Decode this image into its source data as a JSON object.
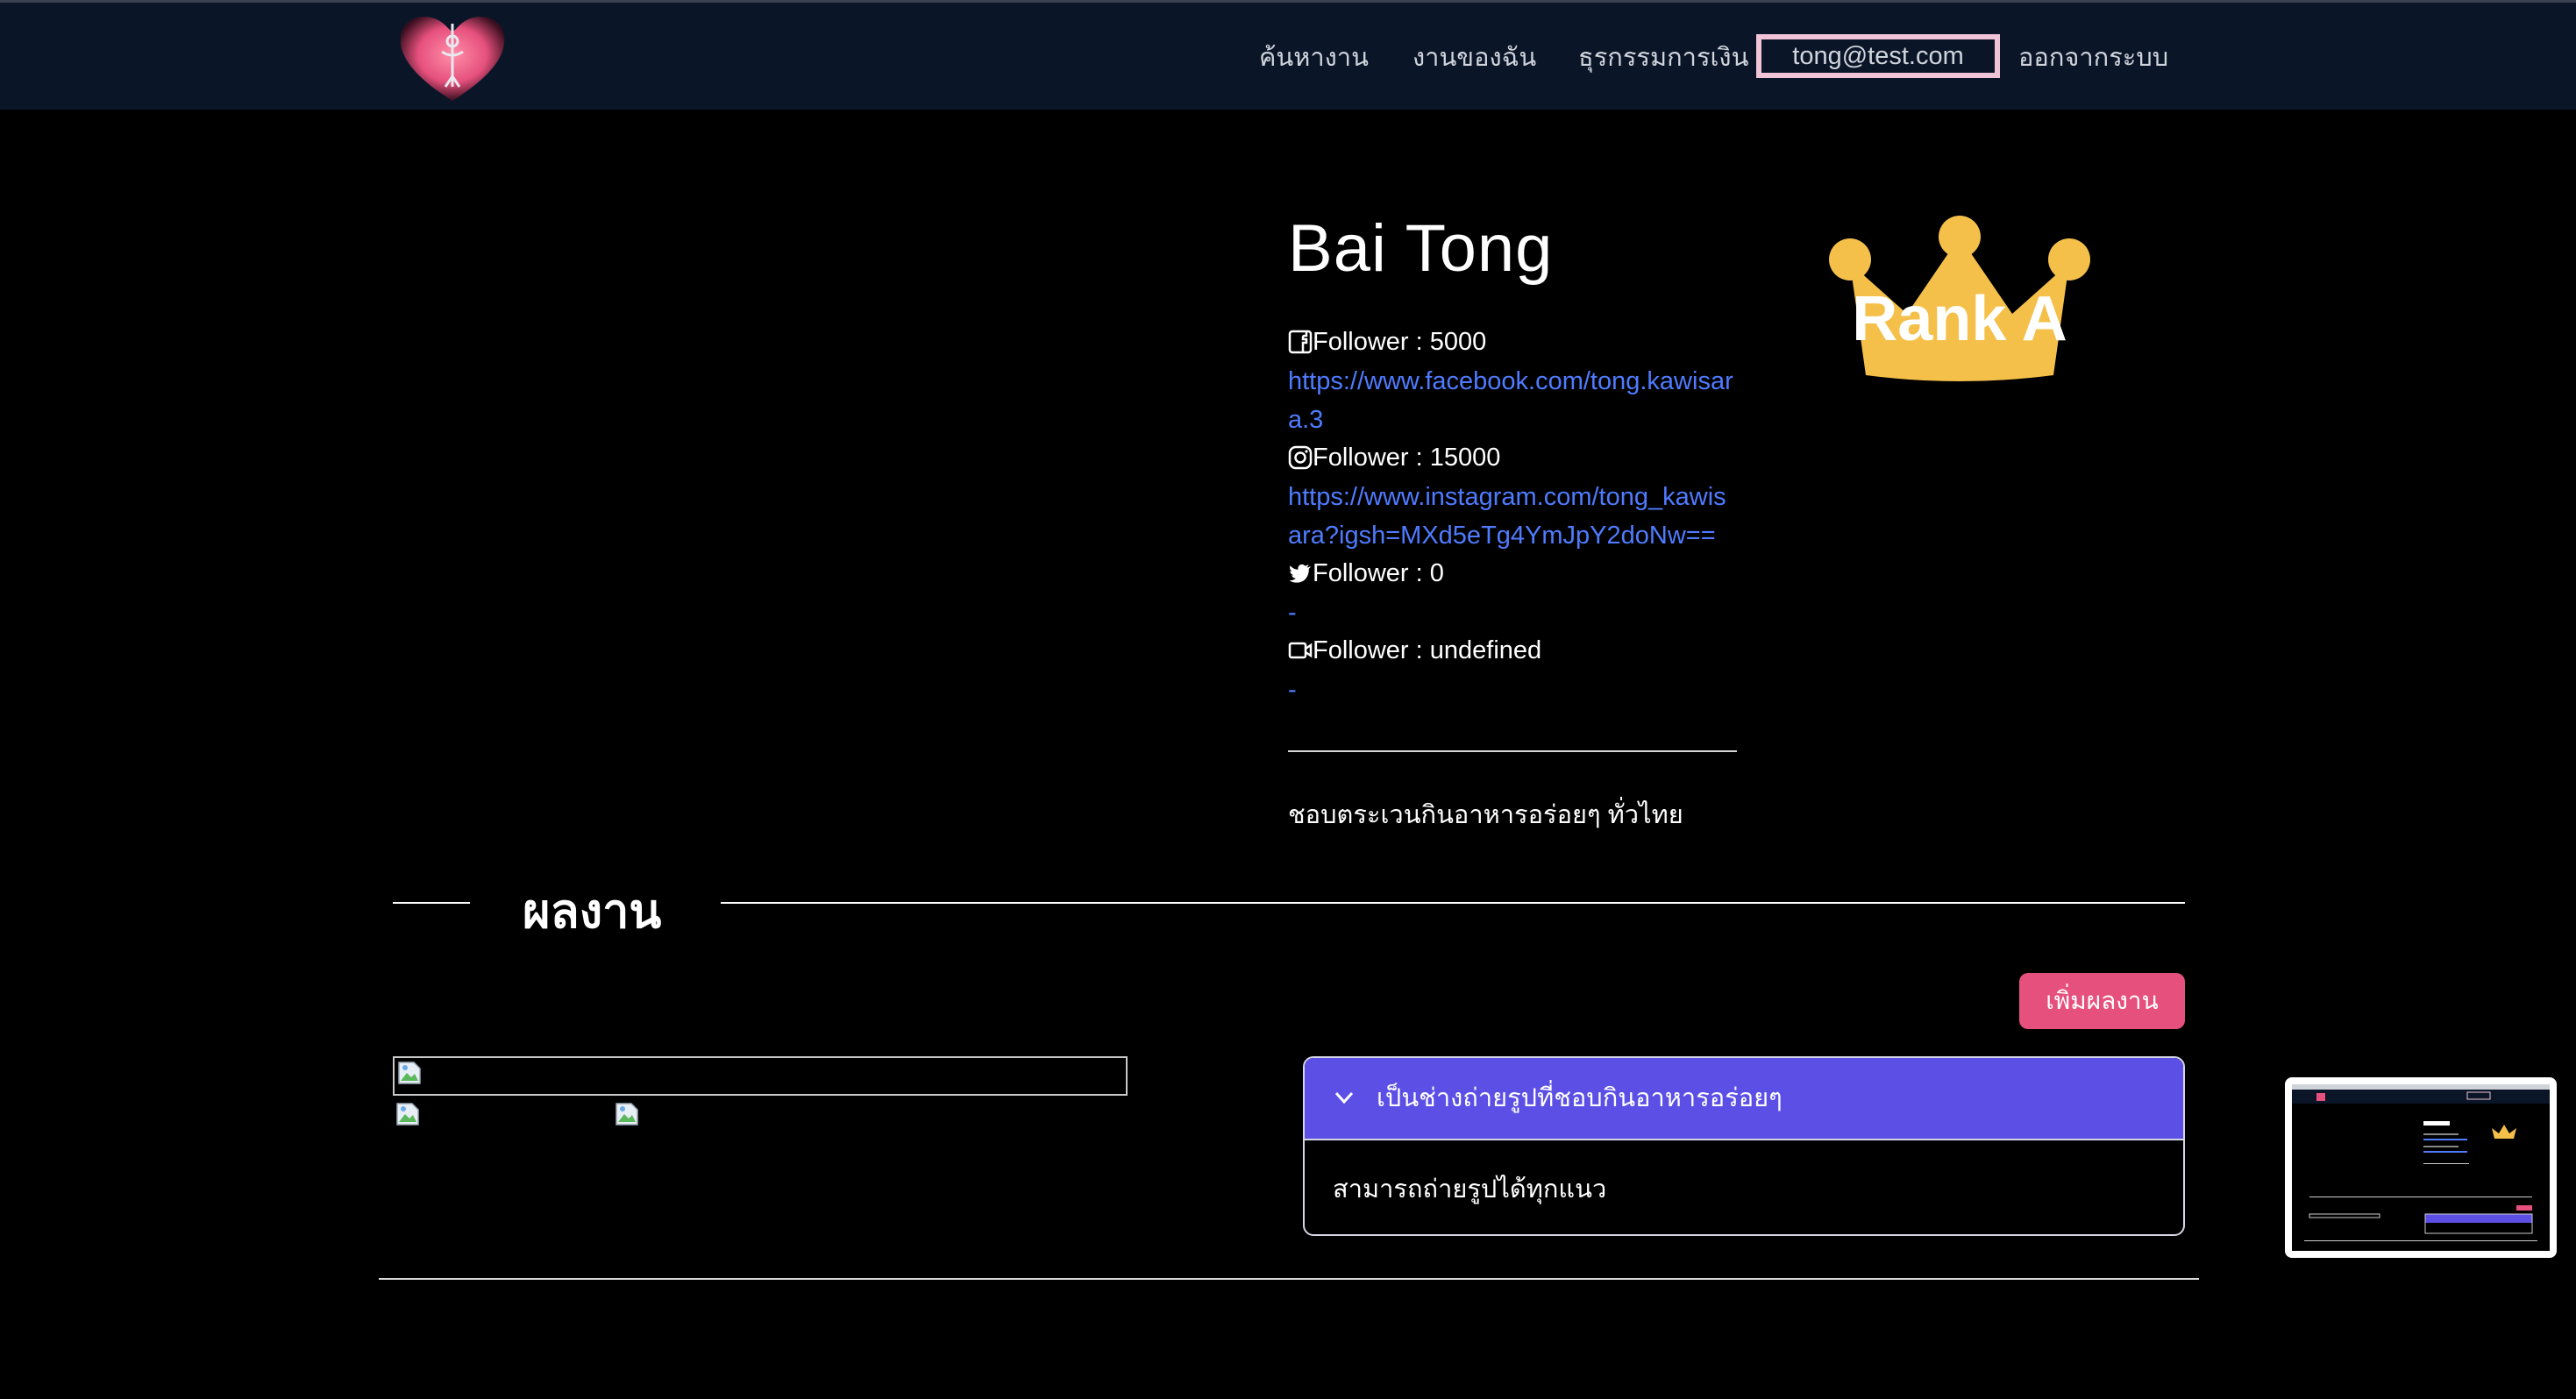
{
  "navbar": {
    "logo_icon": "heart-logo-icon",
    "find_jobs": "ค้นหางาน",
    "my_jobs": "งานของฉัน",
    "transactions": "ธุรกรรมการเงิน",
    "email": "tong@test.com",
    "logout": "ออกจากระบบ"
  },
  "profile": {
    "name": "Bai Tong",
    "rank_label": "Rank A",
    "facebook": {
      "icon": "facebook-icon",
      "followers": "Follower : 5000",
      "link": "https://www.facebook.com/tong.kawisara.3"
    },
    "instagram": {
      "icon": "instagram-icon",
      "followers": "Follower : 15000",
      "link": "https://www.instagram.com/tong_kawisara?igsh=MXd5eTg4YmJpY2doNw=="
    },
    "twitter": {
      "icon": "twitter-icon",
      "followers": "Follower : 0",
      "link": "-"
    },
    "video": {
      "icon": "video-icon",
      "followers": "Follower : undefined",
      "link": "-"
    },
    "bio": "ชอบตระเวนกินอาหารอร่อยๆ ทั่วไทย"
  },
  "works": {
    "section_title": "ผลงาน",
    "add_button": "เพิ่มผลงาน",
    "accordion": {
      "title": "เป็นช่างถ่ายรูปที่ชอบกินอาหารอร่อยๆ",
      "body": "สามารถถ่ายรูปได้ทุกแนว"
    }
  },
  "colors": {
    "navbar_bg": "#0a1628",
    "accent_pink": "#e6507d",
    "accordion_purple": "#5b4fe6",
    "link_blue": "#4f7bff",
    "crown_gold": "#f5c04a"
  }
}
